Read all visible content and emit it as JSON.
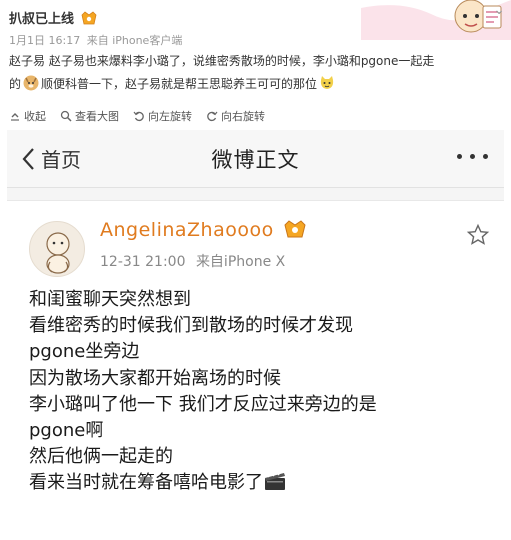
{
  "post": {
    "author": "扒叔已上线",
    "date": "1月1日 16:17",
    "source": "来自 iPhone客户端",
    "text_line1": "赵子易 赵子易也来爆料李小璐了，说维密秀散场的时候，李小璐和pgone一起走",
    "text_line2_a": "的",
    "text_line2_b": "顺便科普一下，赵子易就是帮王思聪养王可可的那位",
    "actions": [
      "收起",
      "查看大图",
      "向左旋转",
      "向右旋转"
    ]
  },
  "screenshot": {
    "back_label": "首页",
    "title": "微博正文",
    "handle": "AngelinaZhaoooo",
    "time": "12-31 21:00",
    "source": "来自iPhone X",
    "lines": [
      "和闺蜜聊天突然想到",
      "看维密秀的时候我们到散场的时候才发现",
      "pgone坐旁边",
      "因为散场大家都开始离场的时候",
      "李小璐叫了他一下 我们才反应过来旁边的是",
      "pgone啊",
      "然后他俩一起走的",
      "看来当时就在筹备嘻哈电影了"
    ]
  },
  "colors": {
    "handle": "#e07b1f",
    "meta": "#999999",
    "nav_bg": "#f7f7f7"
  },
  "icons": [
    "fold-icon",
    "zoom-icon",
    "rotate-left-icon",
    "rotate-right-icon",
    "back-chevron-icon",
    "more-dots-icon",
    "star-icon",
    "clapperboard-icon",
    "doge-emoji-icon",
    "cat-emoji-icon",
    "vip-badge-icon"
  ]
}
